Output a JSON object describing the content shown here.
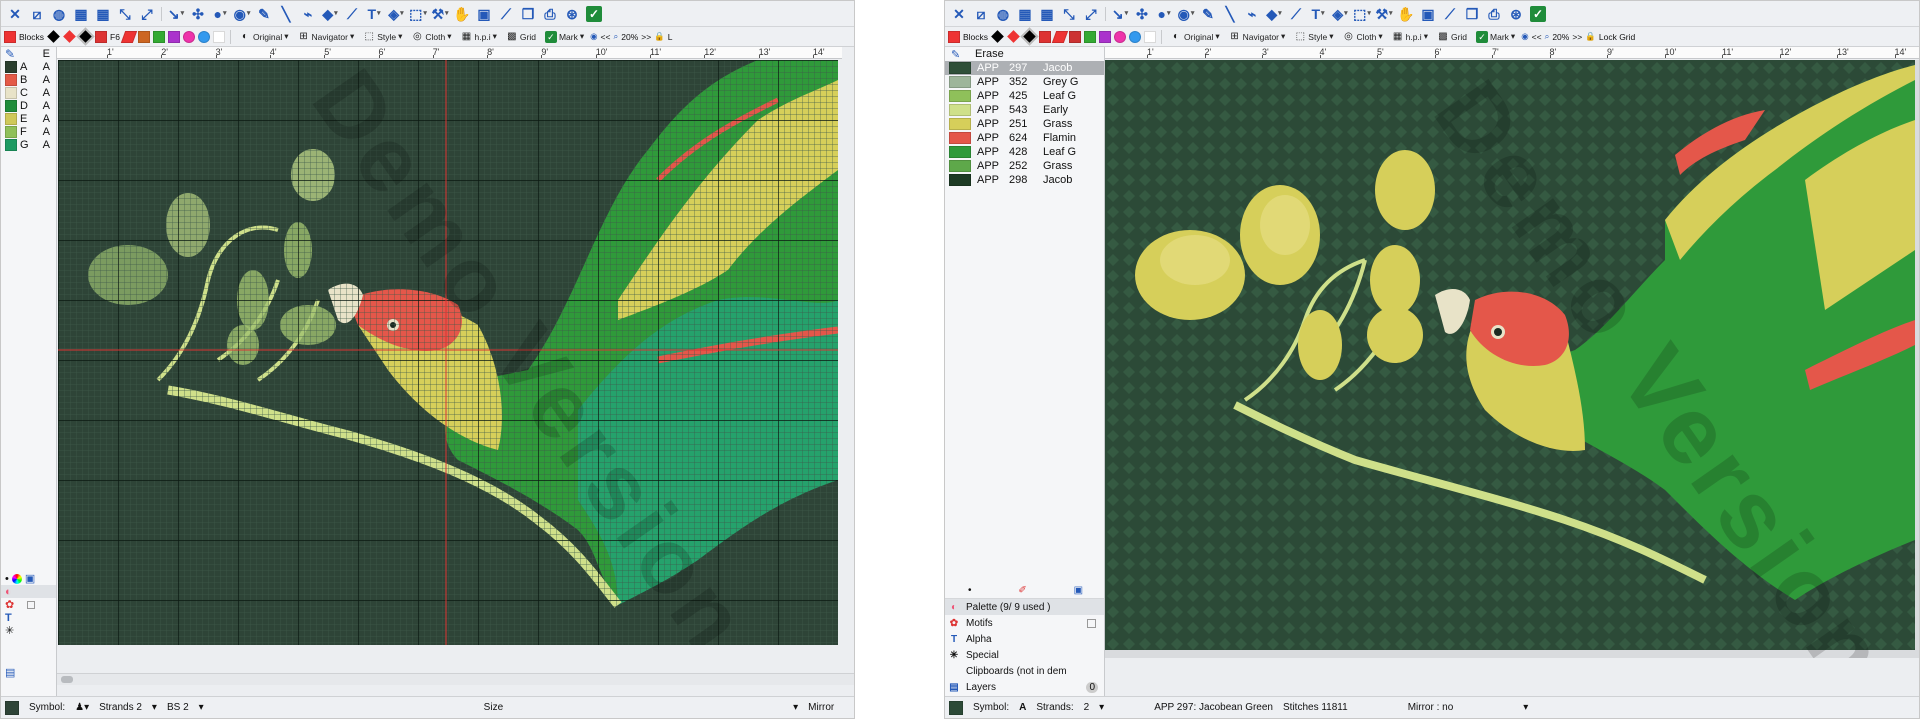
{
  "left_window": {
    "toolbar2": {
      "blocks_label": "Blocks",
      "f6_label": "F6",
      "original_label": "Original",
      "navigator_label": "Navigator",
      "style_label": "Style",
      "cloth_label": "Cloth",
      "hpi_label": "h.p.i",
      "grid_label": "Grid",
      "mark_label": "Mark",
      "nav_back": "<<",
      "zoom": "20%",
      "nav_fwd": ">>",
      "lock_label": "L"
    },
    "ruler": [
      "1'",
      "2'",
      "3'",
      "4'",
      "5'",
      "6'",
      "7'",
      "8'",
      "9'",
      "10'",
      "11'",
      "12'",
      "13'",
      "14'"
    ],
    "sidebar": {
      "header_letter": "E",
      "symbols": [
        {
          "letter": "A",
          "suffix": "A",
          "color": "#2b3f2e"
        },
        {
          "letter": "B",
          "suffix": "A",
          "color": "#e45a47"
        },
        {
          "letter": "C",
          "suffix": "A",
          "color": "#e8e3c8"
        },
        {
          "letter": "D",
          "suffix": "A",
          "color": "#1f8c3a"
        },
        {
          "letter": "E",
          "suffix": "A",
          "color": "#cfc95a"
        },
        {
          "letter": "F",
          "suffix": "A",
          "color": "#8fc05a"
        },
        {
          "letter": "G",
          "suffix": "A",
          "color": "#1d9a62"
        }
      ]
    },
    "watermark": "Demo Version",
    "status": {
      "symbol_label": "Symbol:",
      "strands": "Strands 2",
      "bs": "BS 2",
      "size_label": "Size",
      "mirror_label": "Mirror"
    }
  },
  "right_window": {
    "toolbar2": {
      "blocks_label": "Blocks",
      "original_label": "Original",
      "navigator_label": "Navigator",
      "style_label": "Style",
      "cloth_label": "Cloth",
      "hpi_label": "h.p.i",
      "grid_label": "Grid",
      "mark_label": "Mark",
      "nav_back": "<<",
      "zoom": "20%",
      "nav_fwd": ">>",
      "lock_label": "Lock Grid"
    },
    "ruler": [
      "1'",
      "2'",
      "3'",
      "4'",
      "5'",
      "6'",
      "7'",
      "8'",
      "9'",
      "10'",
      "11'",
      "12'",
      "13'",
      "14'"
    ],
    "palette": {
      "erase_label": "Erase",
      "rows": [
        {
          "brand": "APP",
          "code": "297",
          "name": "Jacob",
          "color": "#2e4f38",
          "selected": true
        },
        {
          "brand": "APP",
          "code": "352",
          "name": "Grey G",
          "color": "#9db59a",
          "selected": false
        },
        {
          "brand": "APP",
          "code": "425",
          "name": "Leaf G",
          "color": "#8fc05a",
          "selected": false
        },
        {
          "brand": "APP",
          "code": "543",
          "name": "Early",
          "color": "#cfe08a",
          "selected": false
        },
        {
          "brand": "APP",
          "code": "251",
          "name": "Grass",
          "color": "#d6cf5a",
          "selected": false
        },
        {
          "brand": "APP",
          "code": "624",
          "name": "Flamin",
          "color": "#e4574a",
          "selected": false
        },
        {
          "brand": "APP",
          "code": "428",
          "name": "Leaf G",
          "color": "#2f9a3a",
          "selected": false
        },
        {
          "brand": "APP",
          "code": "252",
          "name": "Grass",
          "color": "#5ea84a",
          "selected": false
        },
        {
          "brand": "APP",
          "code": "298",
          "name": "Jacob",
          "color": "#1d3a24",
          "selected": false
        }
      ]
    },
    "sections": [
      {
        "label": "Palette (9/ 9 used )",
        "icon": "palette-icon"
      },
      {
        "label": "Motifs",
        "icon": "motifs-icon"
      },
      {
        "label": "Alpha",
        "icon": "alpha-icon"
      },
      {
        "label": "Special",
        "icon": "special-icon"
      },
      {
        "label": "Clipboards (not in dem",
        "icon": "clipboard-icon"
      },
      {
        "label": "Layers",
        "icon": "layers-icon",
        "count": "0"
      }
    ],
    "watermark": "Demo Version",
    "status": {
      "symbol_label": "Symbol:",
      "symbol_value": "A",
      "strands_label": "Strands:",
      "strands_value": "2",
      "thread_info": "APP   297:   Jacobean Green",
      "stitches": "Stitches  11811",
      "mirror": "Mirror : no"
    }
  },
  "colors": {
    "left_bg": "#2e4437",
    "right_bg": "#2c4a37",
    "parrot_red": "#e4574a",
    "parrot_yellow": "#d6cf5a",
    "parrot_green": "#2f9a3a",
    "parrot_teal": "#25a26c",
    "branch": "#cfe08a"
  }
}
